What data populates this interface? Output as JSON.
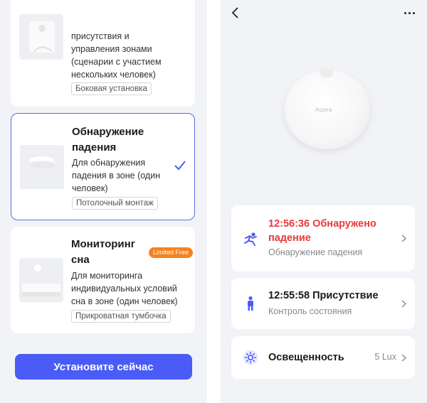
{
  "left": {
    "cards": [
      {
        "title": "",
        "desc_lines": [
          "присутствия и",
          "управления зонами",
          "(сценарии с участием",
          "нескольких человек)"
        ],
        "tag": "Боковая установка"
      },
      {
        "title_lines": [
          "Обнаружение",
          "падения"
        ],
        "desc_lines": [
          "Для обнаружения",
          "падения в зоне (один",
          "человек)"
        ],
        "tag": "Потолочный монтаж",
        "selected": true
      },
      {
        "title_lines": [
          "Мониторинг",
          "сна"
        ],
        "badge": "Limited Free",
        "desc_lines": [
          "Для мониторинга",
          "индивидуальных условий",
          "сна в зоне (один человек)"
        ],
        "tag": "Прикроватная тумбочка"
      }
    ],
    "install_button": "Установите сейчас"
  },
  "right": {
    "device_logo": "Aqara",
    "events": [
      {
        "title_lines": [
          "12:56:36 Обнаружено",
          "падение"
        ],
        "subtitle": "Обнаружение падения",
        "icon": "fall-person-icon",
        "alert": true
      },
      {
        "title_lines": [
          "12:55:58 Присутствие"
        ],
        "subtitle": "Контроль состояния",
        "icon": "person-standing-icon"
      },
      {
        "title_lines": [
          "Освещенность"
        ],
        "value": "5 Lux",
        "icon": "sun-icon"
      }
    ]
  },
  "colors": {
    "accent": "#4a5cf5",
    "alert": "#ea3a3a",
    "badge": "#f7821c",
    "background": "#f2f3f7"
  }
}
